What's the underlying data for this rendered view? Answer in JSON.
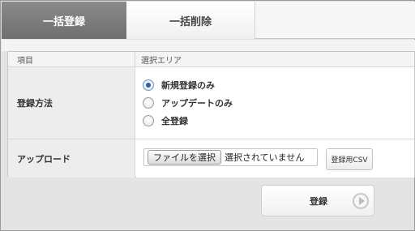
{
  "tabs": [
    {
      "label": "一括登録",
      "active": true
    },
    {
      "label": "一括削除",
      "active": false
    }
  ],
  "table": {
    "header": {
      "col1": "項目",
      "col2": "選択エリア"
    },
    "method": {
      "label": "登録方法",
      "options": [
        {
          "label": "新規登録のみ",
          "checked": true
        },
        {
          "label": "アップデートのみ",
          "checked": false
        },
        {
          "label": "全登録",
          "checked": false
        }
      ]
    },
    "upload": {
      "label": "アップロード",
      "file_button": "ファイルを選択",
      "file_status": "選択されていません",
      "csv_button": "登録用CSV"
    }
  },
  "submit": {
    "label": "登録",
    "icon": "play-circle-icon"
  },
  "colors": {
    "active_tab": "#7c7c7c",
    "radio_selected": "#2d5ea8"
  }
}
